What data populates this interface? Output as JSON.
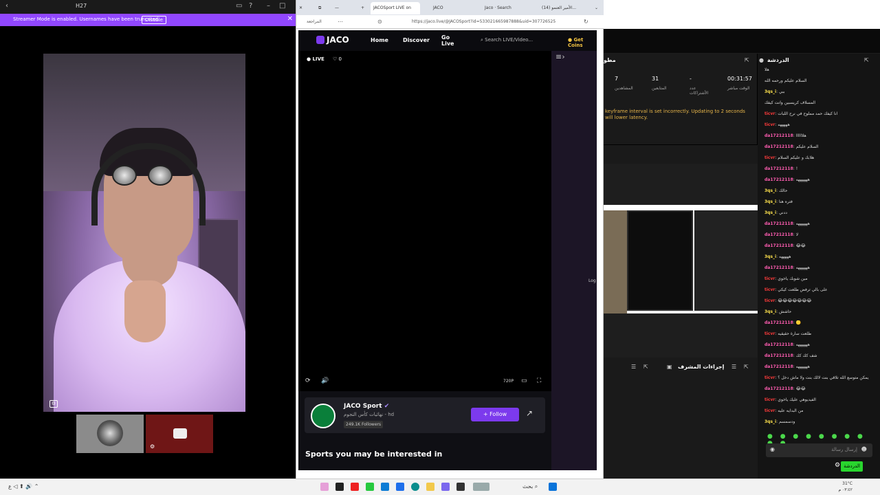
{
  "left_window": {
    "title": "H27",
    "streamer_msg": "Streamer Mode is enabled. Usernames have been truncated.",
    "disable_label": "Disable"
  },
  "browser": {
    "tabs": [
      "JACOSport LIVE on",
      "JACO",
      "Jaco · Search",
      "(14) الأمير العنمو..."
    ],
    "url": "https://jaco.live/@JACOSport?id=533021665987888&uid=307726525",
    "addr_label": "المراجعة"
  },
  "jaco": {
    "logo": "JACO",
    "nav": {
      "home": "Home",
      "discover": "Discover",
      "go_live": "Go Live"
    },
    "search_placeholder": "Search LIVE/Video...",
    "coins": "Get Coins",
    "live_label": "LIVE",
    "likes": "0",
    "quality": "720P",
    "channel": {
      "name": "JACO Sport",
      "subtitle": "نهائيات كأس النجوم - hd",
      "followers": "249.1K Followers",
      "follow_label": "Follow"
    },
    "sports_heading": "Sports you may be interested in",
    "side_label": "Log"
  },
  "obs": {
    "stats_title": "مطو",
    "stats": [
      {
        "value": "00:31:57",
        "label": "الوقت مباشر"
      },
      {
        "value": "-",
        "label": "عدد الأشتراكات"
      },
      {
        "value": "31",
        "label": "المتابعين"
      },
      {
        "value": "7",
        "label": "المشاهدين"
      }
    ],
    "warning": "keyframe interval is set incorrectly. Updating to 2 seconds will lower latency.",
    "actions_title": "إجراءات المشرف"
  },
  "chat": {
    "title": "الدردشة",
    "lines": [
      {
        "user": "",
        "msg": "هلا",
        "color": "#fff"
      },
      {
        "user": "",
        "msg": "السلام عليكم ورحمه الله",
        "color": "#fff"
      },
      {
        "user": "3qs_i",
        "msg": "ببي",
        "color": "#ffe34d"
      },
      {
        "user": "",
        "msg": "المسلاف كريسبين وانت كيفك",
        "color": "#fff"
      },
      {
        "user": "ticvr",
        "msg": "انا كيفك حمد مملوح في نرح اللبات",
        "color": "#ff3b3b"
      },
      {
        "user": "ticvr",
        "msg": "هههههه",
        "color": "#ff3b3b"
      },
      {
        "user": "da17212118",
        "msg": "هلاااااا",
        "color": "#ff5db1"
      },
      {
        "user": "da17212118",
        "msg": "السلام عليكم",
        "color": "#ff5db1"
      },
      {
        "user": "ticvr",
        "msg": "هلابك و عليكم السلام",
        "color": "#ff3b3b"
      },
      {
        "user": "da17212118",
        "msg": "!",
        "color": "#ff5db1"
      },
      {
        "user": "da17212118",
        "msg": "ههههههه",
        "color": "#ff5db1"
      },
      {
        "user": "3qs_i",
        "msg": "حالك",
        "color": "#ffe34d"
      },
      {
        "user": "3qs_i",
        "msg": "فتره هنا",
        "color": "#ffe34d"
      },
      {
        "user": "3qs_i",
        "msg": "ددني",
        "color": "#ffe34d"
      },
      {
        "user": "da17212118",
        "msg": "ههههههه",
        "color": "#ff5db1"
      },
      {
        "user": "da17212118",
        "msg": "لا",
        "color": "#ff5db1"
      },
      {
        "user": "da17212118",
        "msg": "😂😂",
        "color": "#ff5db1"
      },
      {
        "user": "3qs_i",
        "msg": "هههههه",
        "color": "#ffe34d"
      },
      {
        "user": "da17212118",
        "msg": "ههههههه",
        "color": "#ff5db1"
      },
      {
        "user": "ticvr",
        "msg": "مين شوبك ياخوي",
        "color": "#ff3b3b"
      },
      {
        "user": "ticvr",
        "msg": "على بالي ترفض طلعت كيكي",
        "color": "#ff3b3b"
      },
      {
        "user": "ticvr",
        "msg": "😂😂😂😂😂😂😂",
        "color": "#ff3b3b"
      },
      {
        "user": "3qs_i",
        "msg": "حاشش",
        "color": "#ffe34d"
      },
      {
        "user": "da17212118",
        "msg": "🟡",
        "color": "#ff5db1"
      },
      {
        "user": "ticvr",
        "msg": "طلعت سارة حقيقيه",
        "color": "#ff3b3b"
      },
      {
        "user": "da17212118",
        "msg": "ههههههه",
        "color": "#ff5db1"
      },
      {
        "user": "da17212118",
        "msg": "شف كك كك",
        "color": "#ff5db1"
      },
      {
        "user": "da17212118",
        "msg": "ههههههه",
        "color": "#ff5db1"
      },
      {
        "user": "ticvr",
        "msg": "يمكن متوسع الله تلاقي بنت لالك بنت ولا ماش دخل ؟",
        "color": "#ff3b3b"
      },
      {
        "user": "da17212118",
        "msg": "😂😂",
        "color": "#ff5db1"
      },
      {
        "user": "ticvr",
        "msg": "الفيديوهي عليك ياخوي",
        "color": "#ff3b3b"
      },
      {
        "user": "ticvr",
        "msg": "من البدايه عليه",
        "color": "#ff3b3b"
      },
      {
        "user": "3qs_i",
        "msg": "ودسمسم",
        "color": "#ffe34d"
      }
    ],
    "emotes": "● ● ● ● ● ● ● ● ● ●",
    "input_placeholder": "إرسال رسالة",
    "send_label": "الدردشة"
  },
  "taskbar": {
    "time": "٠٣:٤٢ م",
    "date": "٢٠٢٥/٠٨/١٥",
    "weather": "31°C",
    "search": "بحث",
    "lang": "ع"
  }
}
